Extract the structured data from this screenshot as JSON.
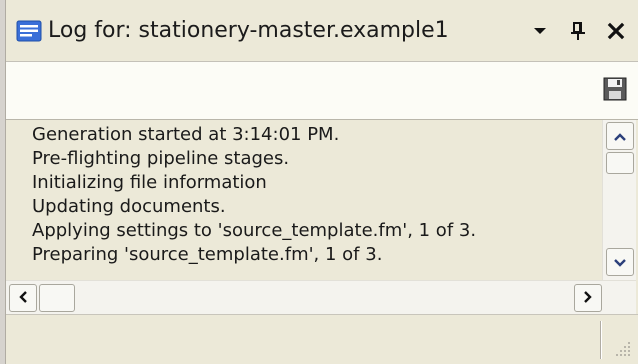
{
  "window": {
    "title": "Log for: stationery-master.example1",
    "icons": {
      "title": "log-window-icon",
      "dropdown": "chevron-down-icon",
      "pin": "pin-icon",
      "close": "close-icon",
      "save": "save-disk-icon",
      "scroll_up": "arrow-up-icon",
      "scroll_down": "arrow-down-icon",
      "scroll_left": "arrow-left-icon",
      "scroll_right": "arrow-right-icon",
      "grip": "resize-grip-icon"
    }
  },
  "log": {
    "lines": [
      "Generation started at 3:14:01 PM.",
      "Pre-flighting pipeline stages.",
      "Initializing file information",
      "Updating documents.",
      "Applying settings to 'source_template.fm', 1 of 3.",
      "Preparing 'source_template.fm', 1 of 3."
    ]
  },
  "colors": {
    "title_icon_blue": "#3a6fd8",
    "frame": "#ece9d8",
    "toolbar": "#fcfcf6"
  }
}
